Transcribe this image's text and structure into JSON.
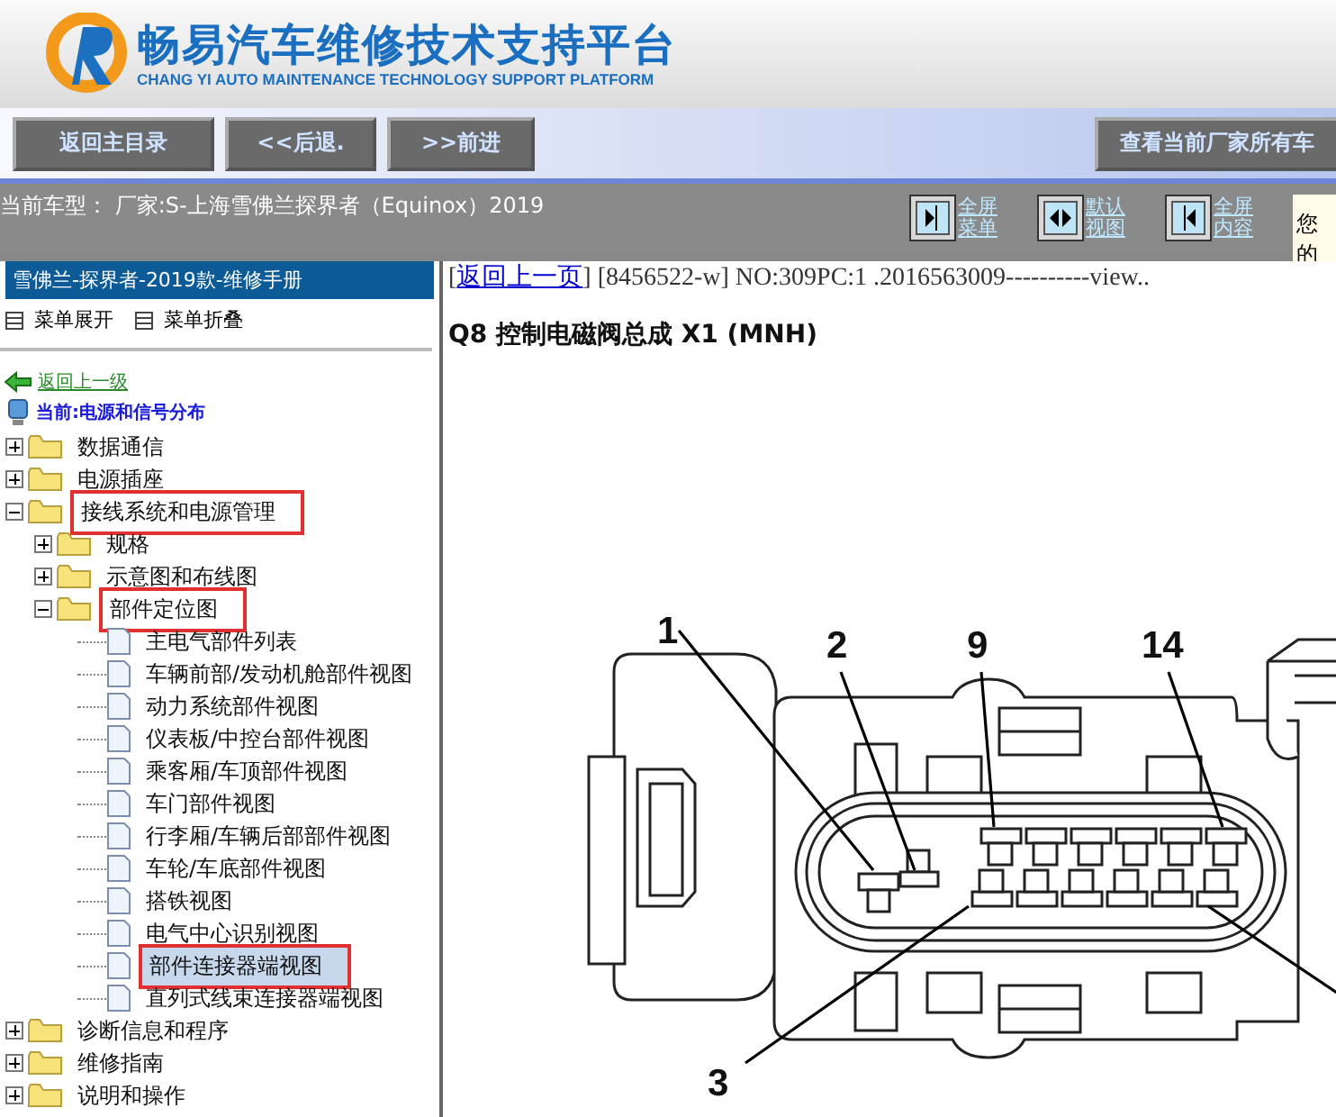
{
  "header": {
    "title": "畅易汽车维修技术支持平台",
    "subtitle": "CHANG YI AUTO MAINTENANCE TECHNOLOGY SUPPORT PLATFORM"
  },
  "toolbar": {
    "buttons": [
      "返回主目录",
      "<<后退.",
      ">>前进"
    ],
    "right_button": "查看当前厂家所有车"
  },
  "vehicle_bar": {
    "current_vehicle": "当前车型： 厂家:S-上海雪佛兰探界者（Equinox）2019",
    "view_buttons": [
      {
        "kind": "menu",
        "label": "全屏菜单"
      },
      {
        "kind": "default",
        "label": "默认视图"
      },
      {
        "kind": "content",
        "label": "全屏内容"
      }
    ],
    "notice": "您的"
  },
  "sidebar": {
    "title": "雪佛兰-探界者-2019款-维修手册",
    "expand_all": "菜单展开",
    "collapse_all": "菜单折叠",
    "back_link": "返回上一级",
    "current": "当前:电源和信号分布",
    "tree": [
      {
        "label": "数据通信",
        "kind": "folder",
        "expanded": false,
        "marked": false,
        "selected": false
      },
      {
        "label": "电源插座",
        "kind": "folder",
        "expanded": false,
        "marked": false,
        "selected": false
      },
      {
        "label": "接线系统和电源管理",
        "kind": "folder",
        "expanded": true,
        "marked": true,
        "selected": false,
        "children": [
          {
            "label": "规格",
            "kind": "folder",
            "expanded": false,
            "marked": false,
            "selected": false
          },
          {
            "label": "示意图和布线图",
            "kind": "folder",
            "expanded": false,
            "marked": false,
            "selected": false
          },
          {
            "label": "部件定位图",
            "kind": "folder",
            "expanded": true,
            "marked": true,
            "selected": false,
            "children": [
              {
                "label": "主电气部件列表",
                "kind": "page",
                "marked": false,
                "selected": false
              },
              {
                "label": "车辆前部/发动机舱部件视图",
                "kind": "page",
                "marked": false,
                "selected": false
              },
              {
                "label": "动力系统部件视图",
                "kind": "page",
                "marked": false,
                "selected": false
              },
              {
                "label": "仪表板/中控台部件视图",
                "kind": "page",
                "marked": false,
                "selected": false
              },
              {
                "label": "乘客厢/车顶部件视图",
                "kind": "page",
                "marked": false,
                "selected": false
              },
              {
                "label": "车门部件视图",
                "kind": "page",
                "marked": false,
                "selected": false
              },
              {
                "label": "行李厢/车辆后部部件视图",
                "kind": "page",
                "marked": false,
                "selected": false
              },
              {
                "label": "车轮/车底部件视图",
                "kind": "page",
                "marked": false,
                "selected": false
              },
              {
                "label": "搭铁视图",
                "kind": "page",
                "marked": false,
                "selected": false
              },
              {
                "label": "电气中心识别视图",
                "kind": "page",
                "marked": false,
                "selected": false
              },
              {
                "label": "部件连接器端视图",
                "kind": "page",
                "marked": true,
                "selected": true
              },
              {
                "label": "直列式线束连接器端视图",
                "kind": "page",
                "marked": false,
                "selected": false
              }
            ]
          }
        ]
      },
      {
        "label": "诊断信息和程序",
        "kind": "folder",
        "expanded": false,
        "marked": false,
        "selected": false
      },
      {
        "label": "维修指南",
        "kind": "folder",
        "expanded": false,
        "marked": false,
        "selected": false
      },
      {
        "label": "说明和操作",
        "kind": "folder",
        "expanded": false,
        "marked": false,
        "selected": false
      }
    ]
  },
  "content": {
    "open_bracket": "[",
    "back_link": "返回上一页",
    "reference": "] [8456522-w] NO:309PC:1 .2016563009----------view..",
    "title": "Q8 控制电磁阀总成 X1 (MNH)",
    "callouts": [
      "1",
      "2",
      "9",
      "14",
      "3"
    ]
  }
}
